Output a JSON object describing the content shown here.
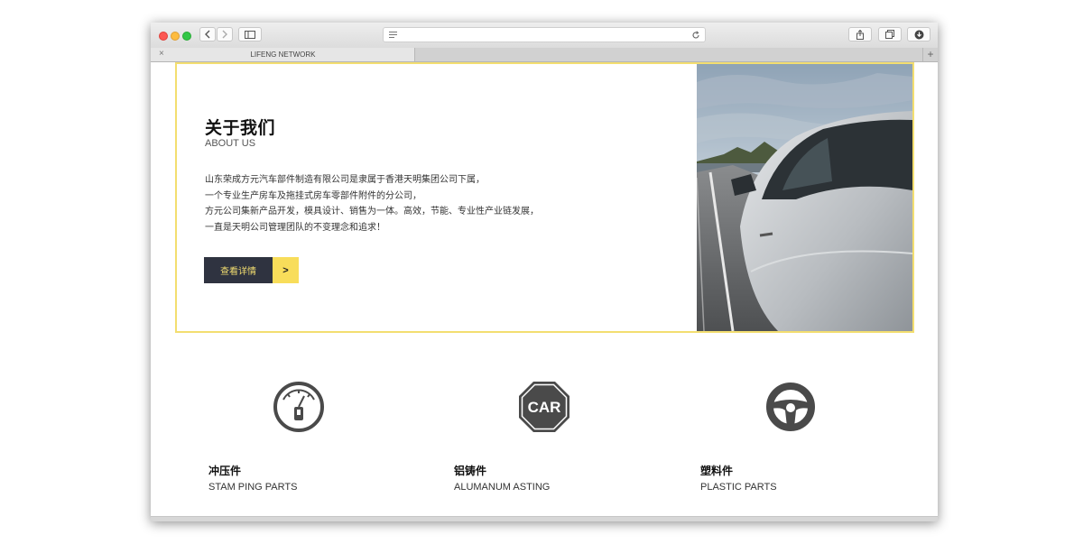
{
  "browser": {
    "tab_title": "LIFENG NETWORK",
    "tab_close": "×",
    "new_tab": "+"
  },
  "about": {
    "title": "关于我们",
    "subtitle": "ABOUT US",
    "paragraph_lines": [
      "山东荣成方元汽车部件制造有限公司是隶属于香港天明集团公司下属，",
      "一个专业生产房车及拖挂式房车零部件附件的分公司，",
      "方元公司集新产品开发，模具设计、销售为一体。高效，节能、专业性产业链发展，",
      "一直是天明公司管理团队的不变理念和追求！"
    ],
    "button_label": "查看详情",
    "button_arrow": ">"
  },
  "features": [
    {
      "title": "冲压件",
      "subtitle": "STAM PING PARTS",
      "icon": "gauge-icon"
    },
    {
      "title": "铝铸件",
      "subtitle": "ALUMANUM ASTING",
      "icon": "car-octagon-icon",
      "icon_text": "CAR"
    },
    {
      "title": "塑料件",
      "subtitle": "PLASTIC PARTS",
      "icon": "steering-wheel-icon"
    }
  ],
  "colors": {
    "accent_yellow": "#f3de70",
    "button_dark": "#2f3340",
    "icon_gray": "#4a4a4a"
  }
}
